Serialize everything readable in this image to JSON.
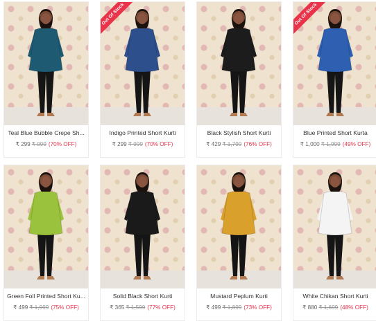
{
  "products": [
    {
      "name": "Teal Blue Bubble Crepe Sh...",
      "price": "₹ 299",
      "mrp": "₹ 999",
      "off": "(70% OFF)",
      "badge": "",
      "color": "#1f5a73"
    },
    {
      "name": "Indigo Printed Short Kurti",
      "price": "₹ 299",
      "mrp": "₹ 999",
      "off": "(70% OFF)",
      "badge": "Out Of Stock",
      "color": "#2d4f8c"
    },
    {
      "name": "Black Stylish Short Kurti",
      "price": "₹ 429",
      "mrp": "₹ 1,799",
      "off": "(76% OFF)",
      "badge": "",
      "color": "#1c1c1c"
    },
    {
      "name": "Blue Printed Short Kurta",
      "price": "₹ 1,000",
      "mrp": "₹ 1,999",
      "off": "(49% OFF)",
      "badge": "Out Of Stock",
      "color": "#2e5fb0"
    },
    {
      "name": "Green Foil Printed Short Ku...",
      "price": "₹ 499",
      "mrp": "₹ 1,999",
      "off": "(75% OFF)",
      "badge": "",
      "color": "#9ac23c"
    },
    {
      "name": "Solid Black Short Kurti",
      "price": "₹ 365",
      "mrp": "₹ 1,599",
      "off": "(77% OFF)",
      "badge": "",
      "color": "#1a1a1a"
    },
    {
      "name": "Mustard Peplum Kurti",
      "price": "₹ 499",
      "mrp": "₹ 1,899",
      "off": "(73% OFF)",
      "badge": "",
      "color": "#d9a02c"
    },
    {
      "name": "White Chikan Short Kurti",
      "price": "₹ 880",
      "mrp": "₹ 1,699",
      "off": "(48% OFF)",
      "badge": "",
      "color": "#f4f4f4"
    }
  ]
}
